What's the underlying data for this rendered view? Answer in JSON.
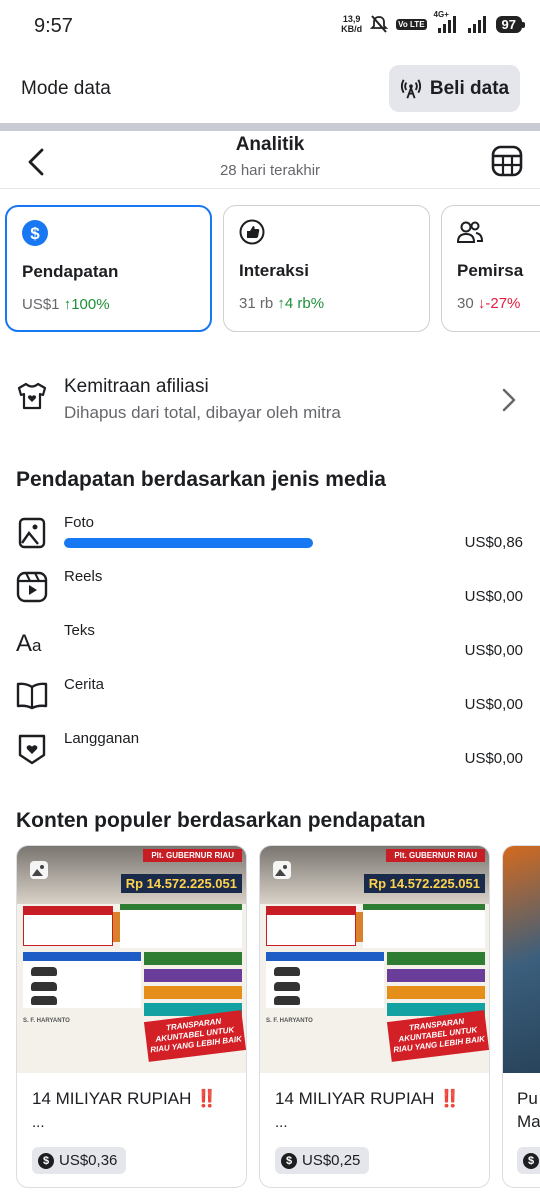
{
  "status_bar": {
    "time": "9:57",
    "net_speed_value": "13,9",
    "net_speed_unit": "KB/d",
    "volte": "Vo LTE",
    "network": "4G+",
    "battery": "97"
  },
  "data_mode": {
    "label": "Mode data",
    "button_label": "Beli data"
  },
  "header": {
    "title": "Analitik",
    "subtitle": "28 hari terakhir"
  },
  "metric_cards": [
    {
      "name": "Pendapatan",
      "value": "US$1",
      "change": "100%",
      "trend": "up",
      "icon": "dollar-icon",
      "selected": true
    },
    {
      "name": "Interaksi",
      "value": "31 rb",
      "change": "4 rb%",
      "trend": "up",
      "icon": "thumb-up-icon",
      "selected": false
    },
    {
      "name": "Pemirsa",
      "value": "30",
      "change": "-27%",
      "trend": "down",
      "icon": "people-icon",
      "selected": false
    }
  ],
  "affiliate": {
    "title": "Kemitraan afiliasi",
    "subtitle": "Dihapus dari total, dibayar oleh mitra"
  },
  "media_section": {
    "title": "Pendapatan berdasarkan jenis media",
    "items": [
      {
        "label": "Foto",
        "value": "US$0,86",
        "share": 1.0,
        "icon": "photo-icon"
      },
      {
        "label": "Reels",
        "value": "US$0,00",
        "share": 0,
        "icon": "reels-icon"
      },
      {
        "label": "Teks",
        "value": "US$0,00",
        "share": 0,
        "icon": "text-icon"
      },
      {
        "label": "Cerita",
        "value": "US$0,00",
        "share": 0,
        "icon": "book-icon"
      },
      {
        "label": "Langganan",
        "value": "US$0,00",
        "share": 0,
        "icon": "heart-badge-icon"
      }
    ]
  },
  "popular_section": {
    "title": "Konten populer berdasarkan pendapatan",
    "items": [
      {
        "title": "14 MILIYAR RUPIAH ‼️",
        "ellipsis": "...",
        "earnings": "US$0,36",
        "image": {
          "banner": "Plt. GUBERNUR RIAU",
          "total": "Rp 14.572.225.051",
          "stamp": "TRANSPARAN AKUNTABEL UNTUK RIAU YANG LEBIH BAIK",
          "name": "S. F. HARYANTO"
        }
      },
      {
        "title": "14 MILIYAR RUPIAH ‼️",
        "ellipsis": "...",
        "earnings": "US$0,25",
        "image": {
          "banner": "Plt. GUBERNUR RIAU",
          "total": "Rp 14.572.225.051",
          "stamp": "TRANSPARAN AKUNTABEL UNTUK RIAU YANG LEBIH BAIK",
          "name": "S. F. HARYANTO"
        }
      },
      {
        "title": "Pu",
        "title_line2": "Ma",
        "earnings": ""
      }
    ]
  },
  "colors": {
    "accent": "#1877f2",
    "positive": "#1f8f3a",
    "negative": "#e41e3f",
    "muted_text": "#65676b"
  }
}
